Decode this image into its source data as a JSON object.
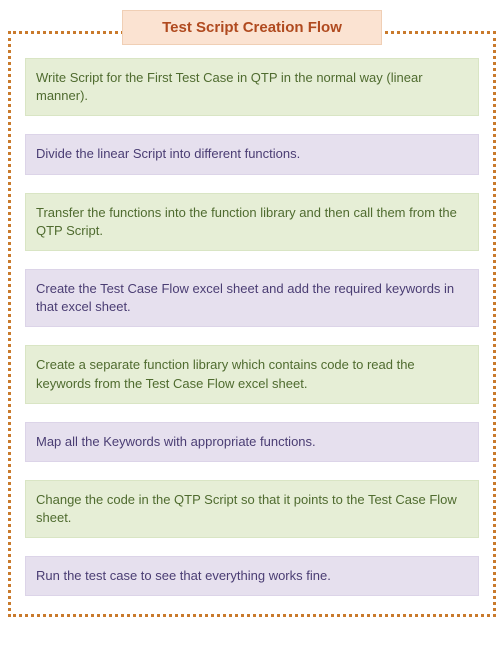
{
  "title": "Test Script Creation Flow",
  "steps": {
    "s0": "Write Script for the First Test Case in QTP in the normal way (linear manner).",
    "s1": "Divide the linear Script into different functions.",
    "s2": "Transfer the functions into the function library and then call them from the QTP Script.",
    "s3": "Create the Test Case Flow excel sheet and add the required keywords in that excel sheet.",
    "s4": "Create a separate function library  which contains code to read the keywords from the Test Case Flow excel sheet.",
    "s5": "Map all the Keywords with appropriate functions.",
    "s6": "Change the code in the QTP Script so that it points to the Test Case Flow sheet.",
    "s7": "Run the test case to see that everything works fine."
  }
}
